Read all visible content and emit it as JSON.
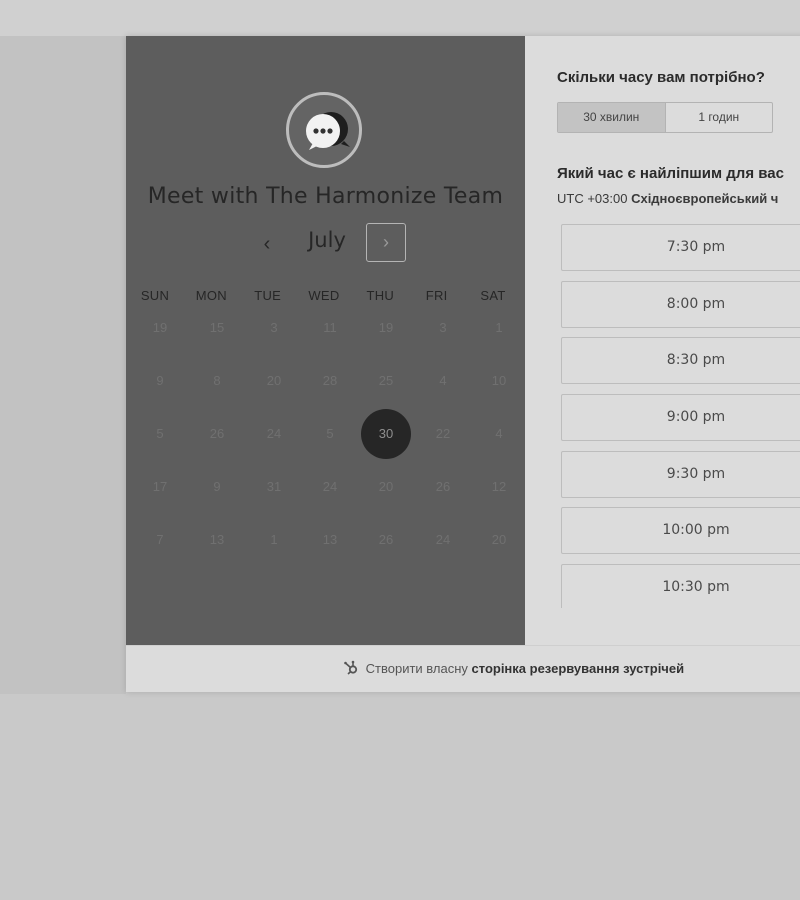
{
  "host": {
    "title": "Meet with The Harmonize Team",
    "avatar_icon": "chat-bubble-icon"
  },
  "calendar": {
    "month": "July",
    "prev_icon": "‹",
    "next_icon": "›",
    "weekdays": [
      "SUN",
      "MON",
      "TUE",
      "WED",
      "THU",
      "FRI",
      "SAT"
    ],
    "weeks": [
      [
        "19",
        "15",
        "3",
        "11",
        "19",
        "3",
        "1"
      ],
      [
        "9",
        "8",
        "20",
        "28",
        "25",
        "4",
        "10"
      ],
      [
        "5",
        "26",
        "24",
        "5",
        "30",
        "22",
        "4"
      ],
      [
        "17",
        "9",
        "31",
        "24",
        "20",
        "26",
        "12"
      ],
      [
        "7",
        "13",
        "1",
        "13",
        "26",
        "24",
        "20"
      ]
    ],
    "selected": "30"
  },
  "duration": {
    "question": "Скільки часу вам потрібно?",
    "options": [
      "30 хвилин",
      "1 годин"
    ],
    "active": "30 хвилин"
  },
  "time": {
    "question": "Який час є найліпшим для вас",
    "tz_offset": "UTC +03:00",
    "tz_name": "Східноєвропейський ч",
    "slots": [
      "7:30 pm",
      "8:00 pm",
      "8:30 pm",
      "9:00 pm",
      "9:30 pm",
      "10:00 pm",
      "10:30 pm"
    ]
  },
  "footer": {
    "prefix": "Створити власну",
    "link": "сторінка резервування зустрічей",
    "icon": "hubspot-sprocket-icon"
  },
  "colors": {
    "left_panel": "#5d5d5d",
    "right_panel": "#dcdcdc",
    "selected_day": "#262626",
    "text_dark": "#262626"
  }
}
